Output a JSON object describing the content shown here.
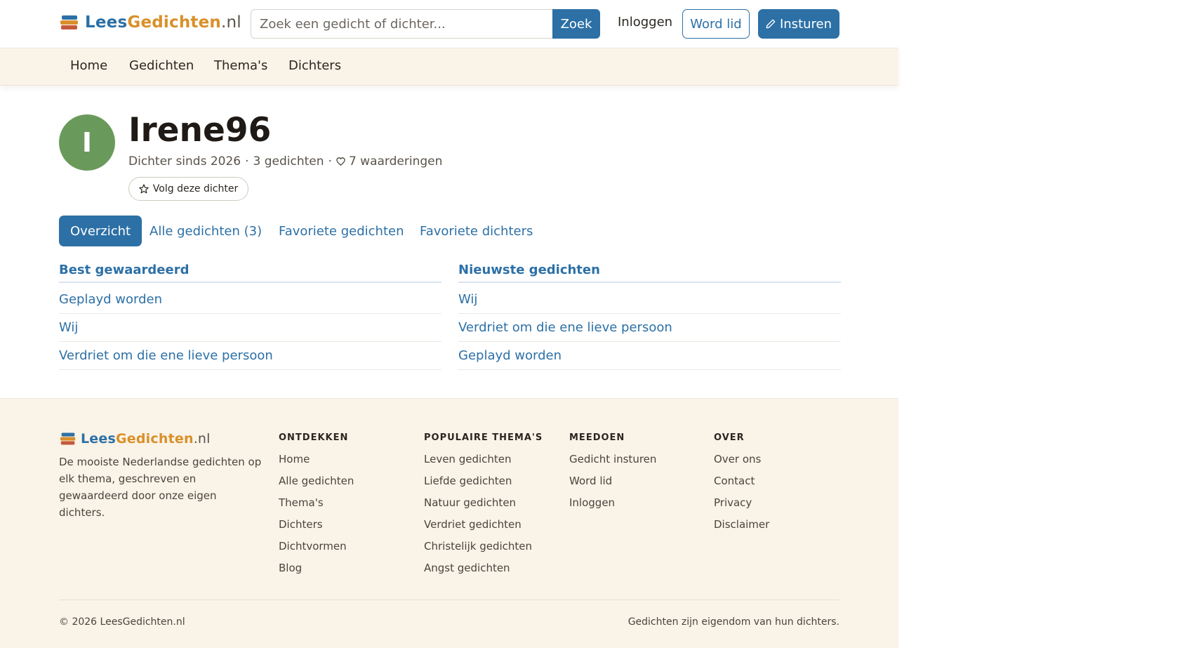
{
  "header": {
    "logo": {
      "part1": "Lees",
      "part2": "Gedichten",
      "part3": ".nl"
    },
    "search": {
      "placeholder": "Zoek een gedicht of dichter...",
      "button": "Zoek"
    },
    "login": "Inloggen",
    "join": "Word lid",
    "submit": "Insturen"
  },
  "nav": {
    "items": [
      "Home",
      "Gedichten",
      "Thema's",
      "Dichters"
    ]
  },
  "profile": {
    "initial": "I",
    "name": "Irene96",
    "since": "Dichter sinds 2026",
    "poems": "3 gedichten",
    "ratings": "7 waarderingen",
    "follow": "Volg deze dichter"
  },
  "tabs": [
    "Overzicht",
    "Alle gedichten (3)",
    "Favoriete gedichten",
    "Favoriete dichters"
  ],
  "best_rated": {
    "title": "Best gewaardeerd",
    "items": [
      "Geplayd worden",
      "Wij",
      "Verdriet om die ene lieve persoon"
    ]
  },
  "newest": {
    "title": "Nieuwste gedichten",
    "items": [
      "Wij",
      "Verdriet om die ene lieve persoon",
      "Geplayd worden"
    ]
  },
  "footer": {
    "logo": {
      "part1": "Lees",
      "part2": "Gedichten",
      "part3": ".nl"
    },
    "description": "De mooiste Nederlandse gedichten op elk thema, geschreven en gewaardeerd door onze eigen dichters.",
    "columns": [
      {
        "heading": "ONTDEKKEN",
        "links": [
          "Home",
          "Alle gedichten",
          "Thema's",
          "Dichters",
          "Dichtvormen",
          "Blog"
        ]
      },
      {
        "heading": "POPULAIRE THEMA'S",
        "links": [
          "Leven gedichten",
          "Liefde gedichten",
          "Natuur gedichten",
          "Verdriet gedichten",
          "Christelijk gedichten",
          "Angst gedichten"
        ]
      },
      {
        "heading": "MEEDOEN",
        "links": [
          "Gedicht insturen",
          "Word lid",
          "Inloggen"
        ]
      },
      {
        "heading": "OVER",
        "links": [
          "Over ons",
          "Contact",
          "Privacy",
          "Disclaimer"
        ]
      }
    ],
    "copyright": "© 2026 LeesGedichten.nl",
    "note": "Gedichten zijn eigendom van hun dichters."
  },
  "colors": {
    "primary": "#2c70a6",
    "accent": "#d9902a",
    "avatar": "#6a9a5b",
    "cream": "#faf3e8"
  }
}
